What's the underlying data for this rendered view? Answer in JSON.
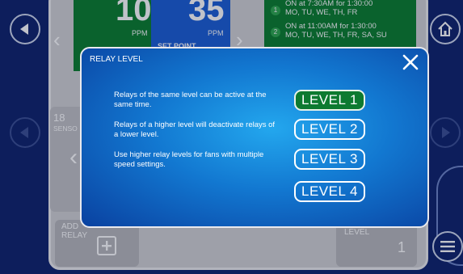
{
  "tiles": {
    "left_value": "10",
    "left_unit": "PPM",
    "right_value": "35",
    "right_unit": "PPM",
    "setpoint_label": "SET POINT"
  },
  "schedules": [
    {
      "num": "1",
      "line1": "ON at 7:30AM for 1:30:00",
      "line2": "MO, TU, WE, TH, FR"
    },
    {
      "num": "2",
      "line1": "ON at 11:00AM for 1:30:00",
      "line2": "MO, TU, WE, TH, FR, SA, SU"
    }
  ],
  "sensor": {
    "count": "18",
    "label": "SENSO"
  },
  "add_relay": {
    "line1": "ADD",
    "line2": "RELAY"
  },
  "level_card": {
    "label": "LEVEL",
    "value": "1"
  },
  "modal": {
    "title": "RELAY LEVEL",
    "paragraphs": [
      "Relays of the same level can be active at the same time.",
      "Relays of a higher level will deactivate relays of a lower level.",
      "Use higher relay levels for fans with multiple speed settings."
    ],
    "levels": [
      "LEVEL 1",
      "LEVEL 2",
      "LEVEL 3",
      "LEVEL 4"
    ],
    "selected_level": "LEVEL 1"
  },
  "colors": {
    "background": "#10246e",
    "modal_center": "#23a7ee",
    "modal_edge": "#0a41a0",
    "active_level": "#0d7a30"
  }
}
